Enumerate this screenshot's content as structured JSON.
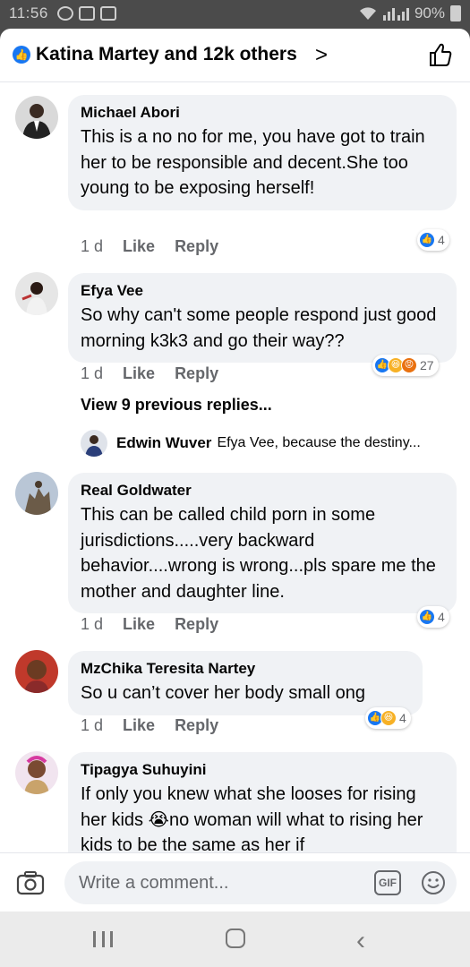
{
  "status": {
    "time": "11:56",
    "battery": "90%"
  },
  "header": {
    "title": "Katina Martey and 12k others",
    "chevron": ">"
  },
  "comments": [
    {
      "author": "Michael Abori",
      "text": "This is a no no for me, you have got to train her to be responsible and decent.She too young to be exposing herself!",
      "age": "1 d",
      "like_label": "Like",
      "reply_label": "Reply",
      "reactions": [
        "like"
      ],
      "reaction_count": "4"
    },
    {
      "author": "Efya Vee",
      "text": "So why can't some people respond just good morning k3k3 and go their way??",
      "age": "1 d",
      "like_label": "Like",
      "reply_label": "Reply",
      "reactions": [
        "like",
        "haha",
        "angry"
      ],
      "reaction_count": "27"
    },
    {
      "author": "Real Goldwater",
      "text": "This can be called child porn in some jurisdictions.....very backward behavior....wrong is wrong...pls spare me the mother and daughter line.",
      "age": "1 d",
      "like_label": "Like",
      "reply_label": "Reply",
      "reactions": [
        "like"
      ],
      "reaction_count": "4"
    },
    {
      "author": "MzChika Teresita Nartey",
      "text": "So u can’t cover her body small ong",
      "age": "1 d",
      "like_label": "Like",
      "reply_label": "Reply",
      "reactions": [
        "like",
        "haha"
      ],
      "reaction_count": "4"
    },
    {
      "author": "Tipagya Suhuyini",
      "text": "If only you knew what she looses for rising her kids 😭no woman will what to rising her kids to be the same as her if"
    }
  ],
  "replies_thread": {
    "view_previous": "View 9 previous replies...",
    "reply_author": "Edwin Wuver",
    "reply_text": "Efya Vee, because the destiny..."
  },
  "composer": {
    "placeholder": "Write a comment...",
    "gif_label": "GIF"
  },
  "colors": {
    "accent": "#1877f2",
    "bubble": "#f0f2f5",
    "muted_text": "#65676b"
  }
}
